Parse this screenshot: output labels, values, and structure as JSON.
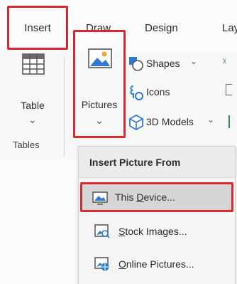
{
  "ribbon_tabs": [
    "Insert",
    "Draw",
    "Design",
    "Lay"
  ],
  "table_group": {
    "button_label": "Table",
    "dropdown_glyph": "⌄",
    "group_label": "Tables"
  },
  "pictures_button": {
    "label": "Pictures",
    "dropdown_glyph": "⌄"
  },
  "illustrations": [
    {
      "label": "Shapes",
      "dropdown_glyph": "⌄",
      "icon": "shapes-icon"
    },
    {
      "label": "Icons",
      "icon": "icons-icon"
    },
    {
      "label": "3D Models",
      "dropdown_glyph": "⌄",
      "icon": "3d-models-icon"
    }
  ],
  "dropdown": {
    "title": "Insert Picture From",
    "items": [
      {
        "label": "This Device...",
        "access_key": "D",
        "icon": "this-device-icon"
      },
      {
        "label": "Stock Images...",
        "access_key": "S",
        "icon": "stock-images-icon"
      },
      {
        "label": "Online Pictures...",
        "access_key": "O",
        "icon": "online-pictures-icon"
      }
    ]
  },
  "colors": {
    "highlight_red": "#d62a32",
    "accent_blue": "#2e7bd1",
    "hover_gray": "#d6d6d6"
  }
}
